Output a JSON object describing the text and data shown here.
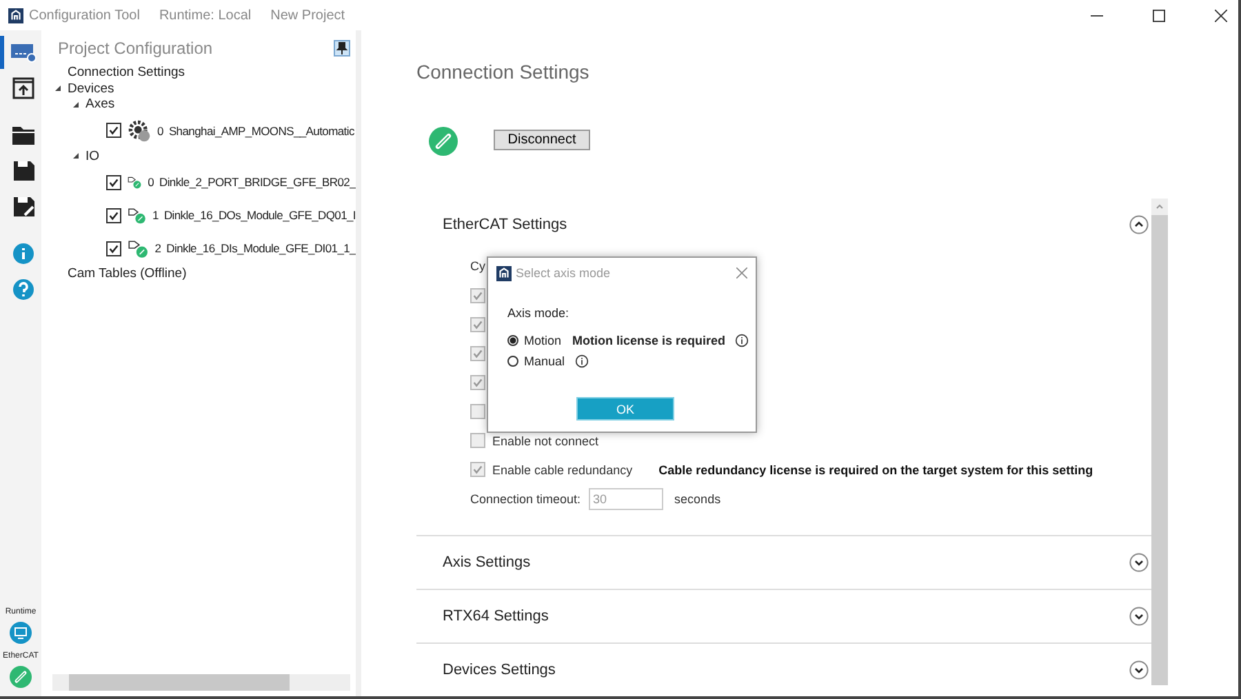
{
  "window": {
    "title": "Configuration Tool",
    "runtime": "Runtime: Local",
    "project": "New Project"
  },
  "toolbar": [
    {
      "kind": "connection",
      "selected": true
    },
    {
      "kind": "upload",
      "selected": false
    },
    {
      "kind": "open",
      "selected": false
    },
    {
      "kind": "save",
      "selected": false
    },
    {
      "kind": "save-as",
      "selected": false
    },
    {
      "kind": "info",
      "selected": false
    },
    {
      "kind": "help",
      "selected": false
    }
  ],
  "status": [
    {
      "label": "Runtime",
      "kind": "runtime"
    },
    {
      "label": "EtherCAT",
      "kind": "ethercat"
    }
  ],
  "project_panel": {
    "title": "Project Configuration",
    "tree": [
      {
        "label": "Connection Settings"
      },
      {
        "label": "Devices",
        "expanded": true,
        "children": [
          {
            "label": "Axes",
            "expanded": true,
            "children": [
              {
                "index": "0",
                "label": "Shanghai_AMP_MOONS__Automatic",
                "checked": true,
                "kind": "axis"
              }
            ]
          },
          {
            "label": "IO",
            "expanded": true,
            "children": [
              {
                "index": "0",
                "label": "Dinkle_2_PORT_BRIDGE_GFE_BR02_",
                "checked": true,
                "kind": "io"
              },
              {
                "index": "1",
                "label": "Dinkle_16_DOs_Module_GFE_DQ01_I",
                "checked": true,
                "kind": "io"
              },
              {
                "index": "2",
                "label": "Dinkle_16_DIs_Module_GFE_DI01_1_",
                "checked": true,
                "kind": "io"
              }
            ]
          }
        ]
      },
      {
        "label": "Cam Tables  (Offline)"
      }
    ]
  },
  "main": {
    "title": "Connection Settings",
    "connected": true,
    "button": "Disconnect",
    "sections": [
      {
        "title": "EtherCAT Settings",
        "expanded": true
      },
      {
        "title": "Axis Settings",
        "expanded": false
      },
      {
        "title": "RTX64 Settings",
        "expanded": false
      },
      {
        "title": "Devices Settings",
        "expanded": false
      }
    ],
    "ethercat": {
      "cycle_label": "Cy",
      "options": [
        {
          "checked": true
        },
        {
          "checked": true
        },
        {
          "checked": true
        },
        {
          "checked": true
        },
        {
          "checked": false
        },
        {
          "label": "Enable not connect",
          "checked": false
        },
        {
          "label": "Enable cable redundancy",
          "checked": true,
          "note": "Cable redundancy license is required on the target system for this setting"
        }
      ],
      "timeout": {
        "label": "Connection timeout:",
        "value": "30",
        "unit": "seconds"
      }
    }
  },
  "dialog": {
    "title": "Select axis mode",
    "label": "Axis mode:",
    "options": [
      {
        "label": "Motion",
        "selected": true,
        "note": "Motion license is required"
      },
      {
        "label": "Manual",
        "selected": false
      }
    ],
    "ok": "OK"
  }
}
